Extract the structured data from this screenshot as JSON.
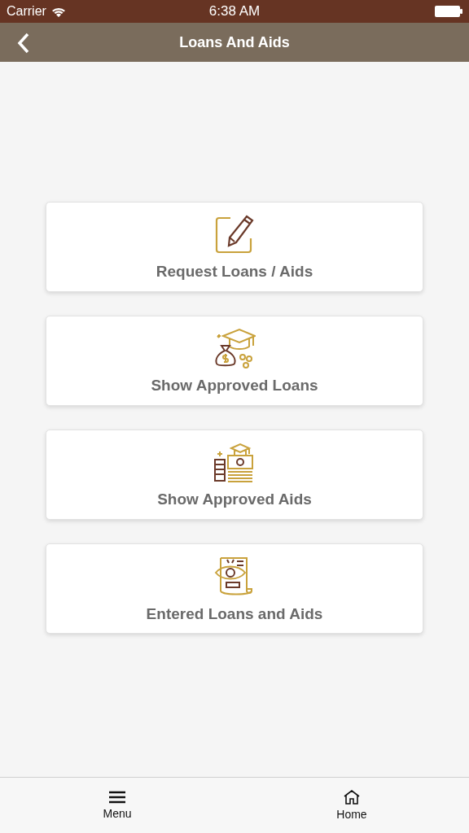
{
  "status_bar": {
    "carrier": "Carrier",
    "time": "6:38 AM"
  },
  "nav_bar": {
    "title": "Loans And Aids"
  },
  "options": [
    {
      "kind": "request",
      "label": "Request Loans / Aids"
    },
    {
      "kind": "loans",
      "label": "Show Approved Loans"
    },
    {
      "kind": "aids",
      "label": "Show Approved Aids"
    },
    {
      "kind": "entered",
      "label": "Entered Loans and Aids"
    }
  ],
  "tab_bar": [
    {
      "kind": "menu",
      "label": "Menu"
    },
    {
      "kind": "home",
      "label": "Home"
    }
  ]
}
